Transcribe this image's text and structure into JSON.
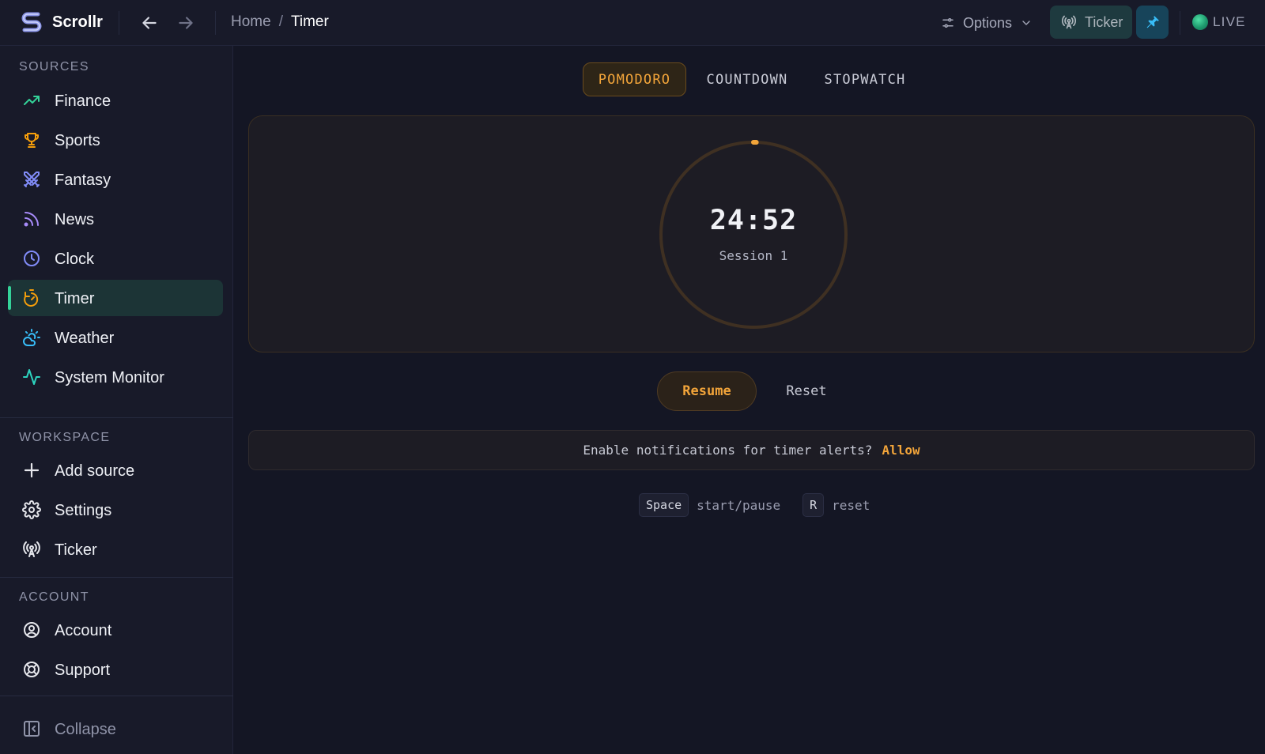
{
  "app": {
    "name": "Scrollr"
  },
  "breadcrumb": {
    "home": "Home",
    "separator": "/",
    "current": "Timer"
  },
  "topbar": {
    "options_label": "Options",
    "ticker_label": "Ticker",
    "live_label": "LIVE"
  },
  "sidebar": {
    "sources_heading": "SOURCES",
    "sources": [
      {
        "label": "Finance",
        "icon": "trending-up-icon"
      },
      {
        "label": "Sports",
        "icon": "trophy-icon"
      },
      {
        "label": "Fantasy",
        "icon": "swords-icon"
      },
      {
        "label": "News",
        "icon": "rss-icon"
      },
      {
        "label": "Clock",
        "icon": "clock-icon"
      },
      {
        "label": "Timer",
        "icon": "timer-icon",
        "active": true
      },
      {
        "label": "Weather",
        "icon": "cloud-sun-icon"
      },
      {
        "label": "System Monitor",
        "icon": "activity-icon"
      }
    ],
    "workspace_heading": "WORKSPACE",
    "workspace": [
      {
        "label": "Add source",
        "icon": "plus-icon"
      },
      {
        "label": "Settings",
        "icon": "gear-icon"
      },
      {
        "label": "Ticker",
        "icon": "broadcast-icon"
      }
    ],
    "account_heading": "ACCOUNT",
    "account": [
      {
        "label": "Account",
        "icon": "user-circle-icon"
      },
      {
        "label": "Support",
        "icon": "lifebuoy-icon"
      }
    ],
    "collapse_label": "Collapse"
  },
  "timer": {
    "tabs": [
      "POMODORO",
      "COUNTDOWN",
      "STOPWATCH"
    ],
    "active_tab": "POMODORO",
    "time": "24:52",
    "session_label": "Session 1",
    "progress": 0.005,
    "resume_label": "Resume",
    "reset_label": "Reset"
  },
  "notification": {
    "message": "Enable notifications for timer alerts?",
    "action": "Allow"
  },
  "shortcuts": [
    {
      "key": "Space",
      "desc": "start/pause"
    },
    {
      "key": "R",
      "desc": "reset"
    }
  ],
  "colors": {
    "accent": "#f3a53a",
    "active_indicator": "#34d399",
    "background": "#141624",
    "sidebar": "#181a29"
  }
}
